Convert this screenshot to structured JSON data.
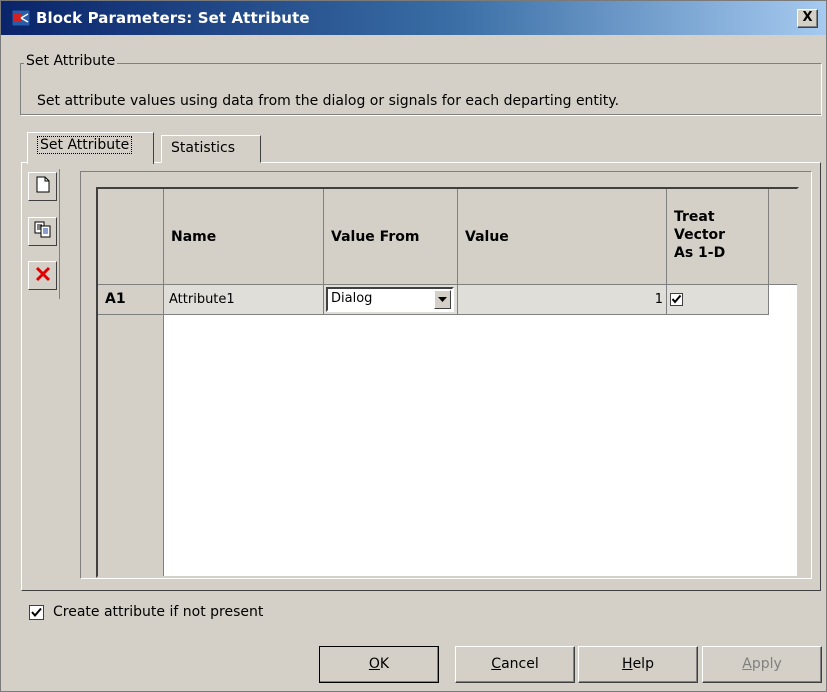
{
  "window": {
    "title": "Block Parameters: Set Attribute",
    "close_glyph": "X"
  },
  "group": {
    "legend": "Set Attribute",
    "description": "Set attribute values using data from the dialog or signals for each departing entity."
  },
  "tabs": [
    {
      "label": "Set Attribute",
      "active": true
    },
    {
      "label": "Statistics",
      "active": false
    }
  ],
  "toolbar": {
    "icons": [
      "new-row-icon",
      "copy-row-icon",
      "delete-row-icon"
    ]
  },
  "table": {
    "columns": [
      "Name",
      "Value From",
      "Value",
      "Treat\nVector\nAs 1-D"
    ],
    "rows": [
      {
        "header": "A1",
        "name": "Attribute1",
        "value_from": "Dialog",
        "value": "1",
        "treat_vector": true
      }
    ]
  },
  "create_attribute": {
    "label": "Create attribute if not present",
    "checked": true
  },
  "buttons": {
    "ok": "OK",
    "ok_mnemonic": "O",
    "ok_rest": "K",
    "cancel": "Cancel",
    "cancel_mnemonic": "C",
    "cancel_rest": "ancel",
    "help": "Help",
    "help_mnemonic": "H",
    "help_rest": "elp",
    "apply": "Apply",
    "apply_mnemonic": "A",
    "apply_rest": "pply"
  },
  "colors": {
    "titlebar_start": "#0a246a",
    "titlebar_end": "#a6caf0",
    "face": "#d4d0c8",
    "delete": "#e00000"
  }
}
